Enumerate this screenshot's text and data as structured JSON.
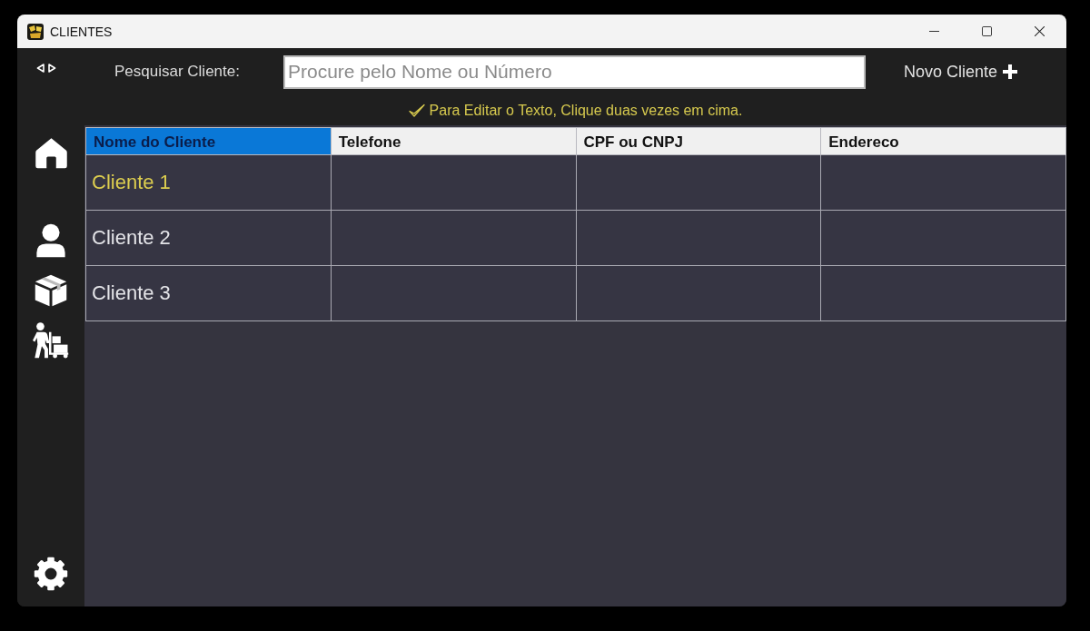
{
  "window": {
    "title": "CLIENTES"
  },
  "toolbar": {
    "search_label": "Pesquisar Cliente:",
    "search": {
      "placeholder": "Procure pelo Nome ou Número"
    },
    "new_button": "Novo Cliente"
  },
  "hint": "Para Editar o Texto, Clique duas vezes em cima.",
  "table": {
    "columns": [
      {
        "label": "Nome do Cliente",
        "selected": true
      },
      {
        "label": "Telefone",
        "selected": false
      },
      {
        "label": "CPF ou CNPJ",
        "selected": false
      },
      {
        "label": "Endereco",
        "selected": false
      }
    ],
    "rows": [
      {
        "cells": [
          "Cliente 1"
        ],
        "selected": true
      },
      {
        "cells": [
          "Cliente 2"
        ],
        "selected": false
      },
      {
        "cells": [
          "Cliente 3"
        ],
        "selected": false
      }
    ]
  }
}
